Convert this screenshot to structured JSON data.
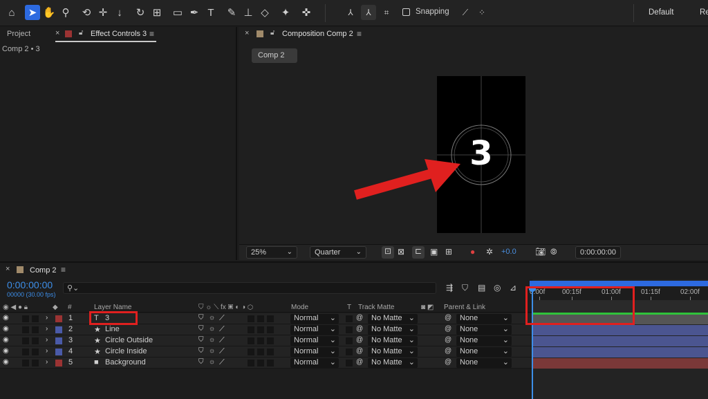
{
  "workspace": {
    "default_label": "Default",
    "review_label": "Re"
  },
  "toolbar": {
    "snapping_label": "Snapping"
  },
  "left_panel": {
    "project_tab": "Project",
    "effect_controls_tab": "Effect Controls 3",
    "breadcrumb": "Comp 2 • 3"
  },
  "composition_panel": {
    "tab_label": "Composition Comp 2",
    "comp_button": "Comp 2",
    "frame_text": "3",
    "zoom": "25%",
    "resolution": "Quarter",
    "exposure": "+0.0",
    "timecode": "0:00:00:00"
  },
  "timeline": {
    "tab_label": "Comp 2",
    "current_time": "0:00:00:00",
    "fps": "00000 (30.00 fps)",
    "columns": {
      "number": "#",
      "layer_name": "Layer Name",
      "mode": "Mode",
      "t": "T",
      "track_matte": "Track Matte",
      "parent": "Parent & Link"
    },
    "ruler": [
      "0:00f",
      "00:15f",
      "01:00f",
      "01:15f",
      "02:00f"
    ],
    "layers": [
      {
        "num": "1",
        "name": "3",
        "type": "T",
        "color": "#9b3333",
        "mode": "Normal",
        "matte": "No Matte",
        "parent": "None"
      },
      {
        "num": "2",
        "name": "Line",
        "type": "★",
        "color": "#4a5aa8",
        "mode": "Normal",
        "matte": "No Matte",
        "parent": "None"
      },
      {
        "num": "3",
        "name": "Circle Outside",
        "type": "★",
        "color": "#4a5aa8",
        "mode": "Normal",
        "matte": "No Matte",
        "parent": "None"
      },
      {
        "num": "4",
        "name": "Circle Inside",
        "type": "★",
        "color": "#4a5aa8",
        "mode": "Normal",
        "matte": "No Matte",
        "parent": "None"
      },
      {
        "num": "5",
        "name": "Background",
        "type": "■",
        "color": "#9b3333",
        "mode": "Normal",
        "matte": "No Matte",
        "parent": "None"
      }
    ]
  },
  "colors": {
    "accent": "#2d6ae0",
    "highlight": "#e0201f",
    "layer_red": "#9b3333",
    "layer_blue": "#4a5aa8"
  }
}
